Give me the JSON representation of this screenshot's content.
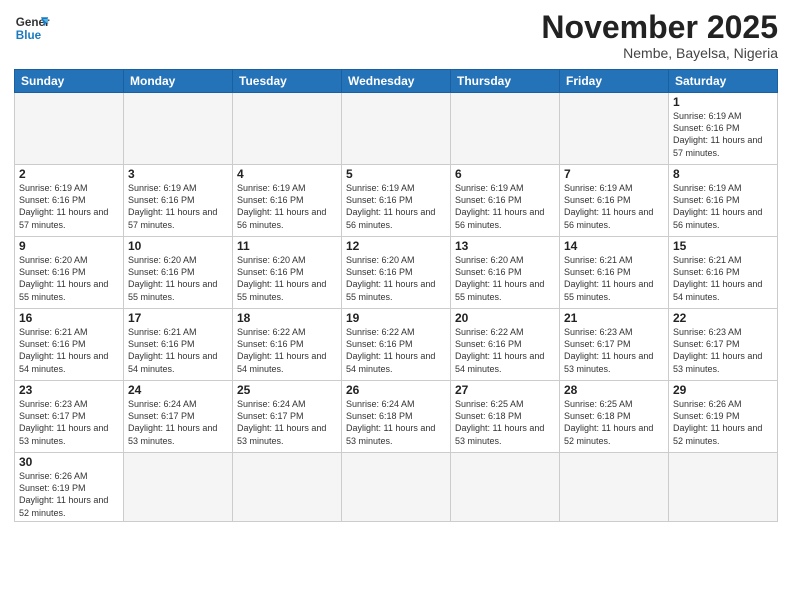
{
  "header": {
    "logo_general": "General",
    "logo_blue": "Blue",
    "title": "November 2025",
    "location": "Nembe, Bayelsa, Nigeria"
  },
  "days_of_week": [
    "Sunday",
    "Monday",
    "Tuesday",
    "Wednesday",
    "Thursday",
    "Friday",
    "Saturday"
  ],
  "weeks": [
    [
      {
        "day": "",
        "info": ""
      },
      {
        "day": "",
        "info": ""
      },
      {
        "day": "",
        "info": ""
      },
      {
        "day": "",
        "info": ""
      },
      {
        "day": "",
        "info": ""
      },
      {
        "day": "",
        "info": ""
      },
      {
        "day": "1",
        "info": "Sunrise: 6:19 AM\nSunset: 6:16 PM\nDaylight: 11 hours\nand 57 minutes."
      }
    ],
    [
      {
        "day": "2",
        "info": "Sunrise: 6:19 AM\nSunset: 6:16 PM\nDaylight: 11 hours\nand 57 minutes."
      },
      {
        "day": "3",
        "info": "Sunrise: 6:19 AM\nSunset: 6:16 PM\nDaylight: 11 hours\nand 57 minutes."
      },
      {
        "day": "4",
        "info": "Sunrise: 6:19 AM\nSunset: 6:16 PM\nDaylight: 11 hours\nand 56 minutes."
      },
      {
        "day": "5",
        "info": "Sunrise: 6:19 AM\nSunset: 6:16 PM\nDaylight: 11 hours\nand 56 minutes."
      },
      {
        "day": "6",
        "info": "Sunrise: 6:19 AM\nSunset: 6:16 PM\nDaylight: 11 hours\nand 56 minutes."
      },
      {
        "day": "7",
        "info": "Sunrise: 6:19 AM\nSunset: 6:16 PM\nDaylight: 11 hours\nand 56 minutes."
      },
      {
        "day": "8",
        "info": "Sunrise: 6:19 AM\nSunset: 6:16 PM\nDaylight: 11 hours\nand 56 minutes."
      }
    ],
    [
      {
        "day": "9",
        "info": "Sunrise: 6:20 AM\nSunset: 6:16 PM\nDaylight: 11 hours\nand 55 minutes."
      },
      {
        "day": "10",
        "info": "Sunrise: 6:20 AM\nSunset: 6:16 PM\nDaylight: 11 hours\nand 55 minutes."
      },
      {
        "day": "11",
        "info": "Sunrise: 6:20 AM\nSunset: 6:16 PM\nDaylight: 11 hours\nand 55 minutes."
      },
      {
        "day": "12",
        "info": "Sunrise: 6:20 AM\nSunset: 6:16 PM\nDaylight: 11 hours\nand 55 minutes."
      },
      {
        "day": "13",
        "info": "Sunrise: 6:20 AM\nSunset: 6:16 PM\nDaylight: 11 hours\nand 55 minutes."
      },
      {
        "day": "14",
        "info": "Sunrise: 6:21 AM\nSunset: 6:16 PM\nDaylight: 11 hours\nand 55 minutes."
      },
      {
        "day": "15",
        "info": "Sunrise: 6:21 AM\nSunset: 6:16 PM\nDaylight: 11 hours\nand 54 minutes."
      }
    ],
    [
      {
        "day": "16",
        "info": "Sunrise: 6:21 AM\nSunset: 6:16 PM\nDaylight: 11 hours\nand 54 minutes."
      },
      {
        "day": "17",
        "info": "Sunrise: 6:21 AM\nSunset: 6:16 PM\nDaylight: 11 hours\nand 54 minutes."
      },
      {
        "day": "18",
        "info": "Sunrise: 6:22 AM\nSunset: 6:16 PM\nDaylight: 11 hours\nand 54 minutes."
      },
      {
        "day": "19",
        "info": "Sunrise: 6:22 AM\nSunset: 6:16 PM\nDaylight: 11 hours\nand 54 minutes."
      },
      {
        "day": "20",
        "info": "Sunrise: 6:22 AM\nSunset: 6:16 PM\nDaylight: 11 hours\nand 54 minutes."
      },
      {
        "day": "21",
        "info": "Sunrise: 6:23 AM\nSunset: 6:17 PM\nDaylight: 11 hours\nand 53 minutes."
      },
      {
        "day": "22",
        "info": "Sunrise: 6:23 AM\nSunset: 6:17 PM\nDaylight: 11 hours\nand 53 minutes."
      }
    ],
    [
      {
        "day": "23",
        "info": "Sunrise: 6:23 AM\nSunset: 6:17 PM\nDaylight: 11 hours\nand 53 minutes."
      },
      {
        "day": "24",
        "info": "Sunrise: 6:24 AM\nSunset: 6:17 PM\nDaylight: 11 hours\nand 53 minutes."
      },
      {
        "day": "25",
        "info": "Sunrise: 6:24 AM\nSunset: 6:17 PM\nDaylight: 11 hours\nand 53 minutes."
      },
      {
        "day": "26",
        "info": "Sunrise: 6:24 AM\nSunset: 6:18 PM\nDaylight: 11 hours\nand 53 minutes."
      },
      {
        "day": "27",
        "info": "Sunrise: 6:25 AM\nSunset: 6:18 PM\nDaylight: 11 hours\nand 53 minutes."
      },
      {
        "day": "28",
        "info": "Sunrise: 6:25 AM\nSunset: 6:18 PM\nDaylight: 11 hours\nand 52 minutes."
      },
      {
        "day": "29",
        "info": "Sunrise: 6:26 AM\nSunset: 6:19 PM\nDaylight: 11 hours\nand 52 minutes."
      }
    ],
    [
      {
        "day": "30",
        "info": "Sunrise: 6:26 AM\nSunset: 6:19 PM\nDaylight: 11 hours\nand 52 minutes."
      },
      {
        "day": "",
        "info": ""
      },
      {
        "day": "",
        "info": ""
      },
      {
        "day": "",
        "info": ""
      },
      {
        "day": "",
        "info": ""
      },
      {
        "day": "",
        "info": ""
      },
      {
        "day": "",
        "info": ""
      }
    ]
  ]
}
